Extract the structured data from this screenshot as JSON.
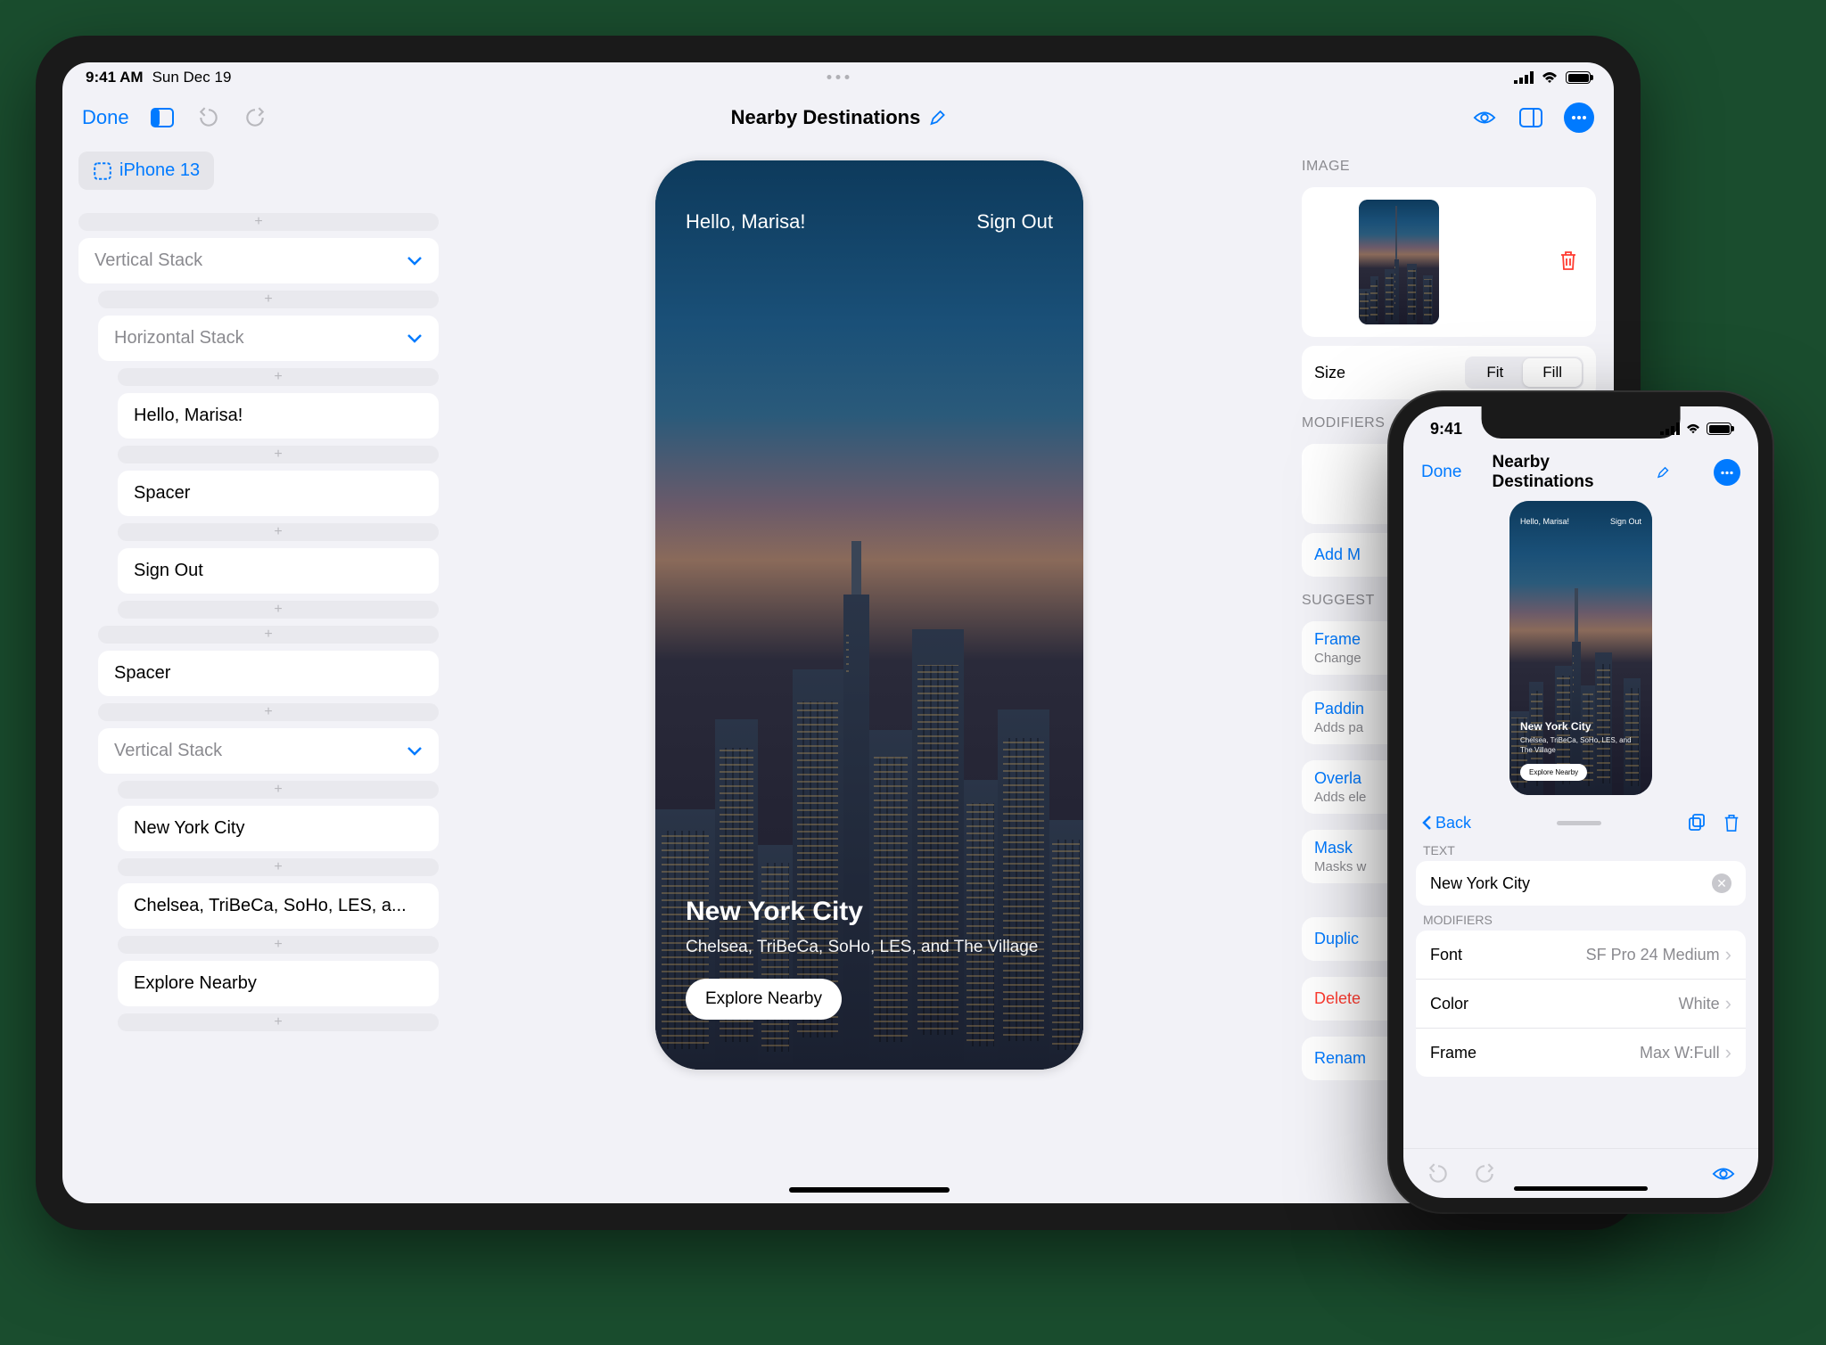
{
  "ipad": {
    "status": {
      "time": "9:41 AM",
      "date": "Sun Dec 19"
    },
    "toolbar": {
      "done": "Done",
      "title": "Nearby Destinations"
    },
    "device_chip": "iPhone 13",
    "tree": {
      "vstack": "Vertical Stack",
      "hstack": "Horizontal Stack",
      "hello": "Hello, Marisa!",
      "spacer": "Spacer",
      "signout": "Sign Out",
      "spacer2": "Spacer",
      "vstack2": "Vertical Stack",
      "nyc": "New York City",
      "subtitle": "Chelsea, TriBeCa, SoHo, LES, a...",
      "explore": "Explore Nearby"
    },
    "preview": {
      "hello": "Hello, Marisa!",
      "signout": "Sign Out",
      "title": "New York City",
      "subtitle": "Chelsea, TriBeCa, SoHo, LES, and The Village",
      "button": "Explore Nearby"
    },
    "inspector": {
      "image_label": "IMAGE",
      "size_label": "Size",
      "fit": "Fit",
      "fill": "Fill",
      "modifiers_label": "MODIFIERS",
      "add": "Add M",
      "suggest_label": "SUGGEST",
      "frame_t": "Frame",
      "frame_s": "Change",
      "padding_t": "Paddin",
      "padding_s": "Adds pa",
      "overlay_t": "Overla",
      "overlay_s": "Adds ele",
      "mask_t": "Mask",
      "mask_s": "Masks w",
      "dup": "Duplic",
      "delete": "Delete",
      "rename": "Renam"
    }
  },
  "iphone": {
    "status_time": "9:41",
    "done": "Done",
    "title": "Nearby Destinations",
    "back": "Back",
    "text_label": "TEXT",
    "text_value": "New York City",
    "modifiers_label": "MODIFIERS",
    "rows": {
      "font_k": "Font",
      "font_v": "SF Pro 24 Medium",
      "color_k": "Color",
      "color_v": "White",
      "frame_k": "Frame",
      "frame_v": "Max W:Full"
    },
    "preview": {
      "hello": "Hello, Marisa!",
      "signout": "Sign Out",
      "title": "New York City",
      "subtitle": "Chelsea, TriBeCa, SoHo, LES, and The Village",
      "button": "Explore Nearby"
    }
  }
}
